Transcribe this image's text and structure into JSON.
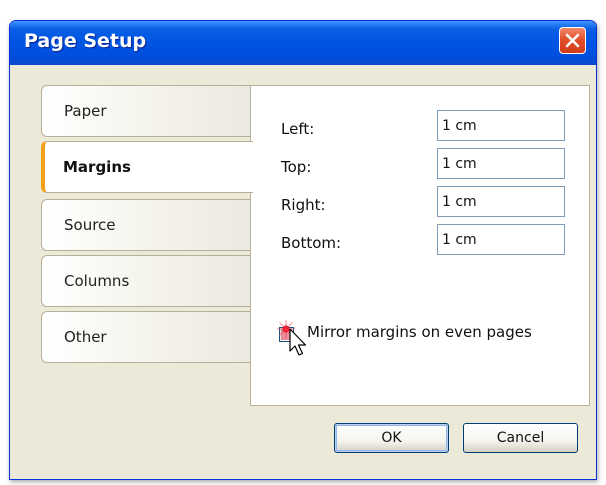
{
  "window": {
    "title": "Page Setup",
    "close_icon": "close-icon"
  },
  "tabs": [
    {
      "label": "Paper",
      "active": false
    },
    {
      "label": "Margins",
      "active": true
    },
    {
      "label": "Source",
      "active": false
    },
    {
      "label": "Columns",
      "active": false
    },
    {
      "label": "Other",
      "active": false
    }
  ],
  "margins": {
    "left": {
      "label": "Left:",
      "value": "1 cm"
    },
    "top": {
      "label": "Top:",
      "value": "1 cm"
    },
    "right": {
      "label": "Right:",
      "value": "1 cm"
    },
    "bottom": {
      "label": "Bottom:",
      "value": "1 cm"
    },
    "mirror": {
      "label": "Mirror margins on even pages",
      "checked": false
    }
  },
  "buttons": {
    "ok": "OK",
    "cancel": "Cancel"
  },
  "colors": {
    "titlebar": "#0055e5",
    "active_tab_accent": "#f3a01a",
    "close_button": "#e2512a"
  }
}
